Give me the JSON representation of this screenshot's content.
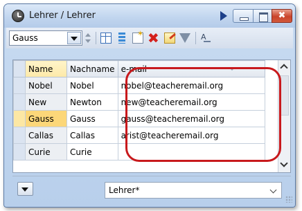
{
  "window": {
    "title": "Lehrer / Lehrer",
    "icon": "clock-icon",
    "controls": [
      "play-icon",
      "minimize-icon",
      "maximize-icon",
      "close-icon"
    ],
    "close_glyph": "✖"
  },
  "toolbar": {
    "combo_value": "Gauss",
    "icons": [
      "spin-icon",
      "table-icon",
      "list-icon",
      "new-record-icon",
      "delete-icon",
      "edit-icon",
      "filter-icon",
      "sort-icon"
    ],
    "delete_glyph": "✖",
    "sort_label": "A"
  },
  "grid": {
    "columns": [
      "Name",
      "Nachname",
      "e-mail"
    ],
    "rows": [
      {
        "name": "Nobel",
        "last": "Nobel",
        "mail": "nobel@teacheremail.org"
      },
      {
        "name": "New",
        "last": "Newton",
        "mail": "new@teacheremail.org"
      },
      {
        "name": "Gauss",
        "last": "Gauss",
        "mail": "gauss@teacheremail.org"
      },
      {
        "name": "Callas",
        "last": "Callas",
        "mail": "arist@teacheremail.org"
      },
      {
        "name": "Curie",
        "last": "Curie",
        "mail": ""
      }
    ],
    "active_row": 2,
    "highlight_color": "#c8191c"
  },
  "footer": {
    "combo_value": "Lehrer*"
  }
}
